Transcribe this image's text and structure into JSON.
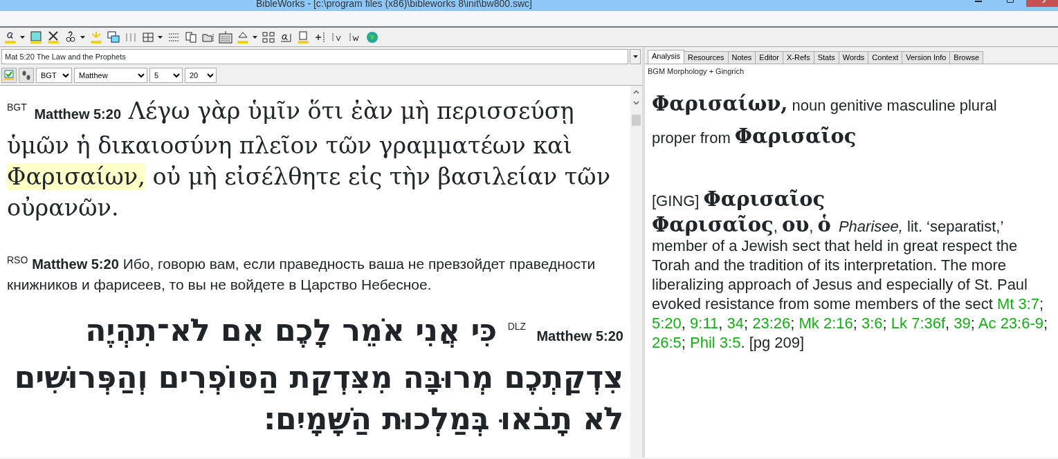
{
  "window": {
    "title": "BibleWorks - [c:\\program files (x86)\\bibleworks 8\\init\\bw800.swc]"
  },
  "left_pane": {
    "reference_box": "Mat 5:20 The Law and the Prophets",
    "selectors": [
      {
        "kind": "version",
        "value": "BGT"
      },
      {
        "kind": "book",
        "value": "Matthew"
      },
      {
        "kind": "chapter",
        "value": "5"
      },
      {
        "kind": "verse",
        "value": "20"
      }
    ],
    "verses": [
      {
        "kind": "greek",
        "version": "BGT",
        "reference": "Matthew 5:20",
        "parts": [
          {
            "text": "Λέγω γὰρ ὑμῖν ὅτι ἐὰν μὴ περισσεύσῃ ὑμῶν ἡ δικαιοσύνη πλεῖον τῶν γραμματέων καὶ ",
            "highlighted": false
          },
          {
            "text": "Φαρισαίων,",
            "highlighted": true
          },
          {
            "text": " οὐ μὴ εἰσέλθητε εἰς τὴν βασιλείαν τῶν οὐρανῶν.",
            "highlighted": false
          }
        ]
      },
      {
        "kind": "russian",
        "version": "RSO",
        "reference": "Matthew 5:20",
        "parts": [
          {
            "text": "Ибо, говорю вам, если праведность ваша не превзойдет праведности книжников и фарисеев, то вы не войдете в Царство Небесное.",
            "highlighted": false
          }
        ]
      },
      {
        "kind": "hebrew",
        "version": "DLZ",
        "reference": "Matthew 5:20",
        "parts": [
          {
            "text": "כִּי אֲנִי אֹמֵר לָכֶם אִם לֹא־תִהְיֶה צִדְקַתְכֶם מְרוּבָּה מִצִּדְקַת הַסּוֹפְרִים וְהַפְּרוּשִׁים לֹא תָבֹאוּ בְּמַלְכוּת הַשָּׁמָיִם׃",
            "highlighted": false
          }
        ]
      }
    ]
  },
  "right_pane": {
    "tabs": [
      {
        "label": "Analysis",
        "selected": true
      },
      {
        "label": "Resources",
        "selected": false
      },
      {
        "label": "Notes",
        "selected": false
      },
      {
        "label": "Editor",
        "selected": false
      },
      {
        "label": "X-Refs",
        "selected": false
      },
      {
        "label": "Stats",
        "selected": false
      },
      {
        "label": "Words",
        "selected": false
      },
      {
        "label": "Context",
        "selected": false
      },
      {
        "label": "Version Info",
        "selected": false
      },
      {
        "label": "Browse",
        "selected": false
      }
    ],
    "subtitle": "BGM Morphology + Gingrich",
    "analysis": {
      "word": "Φαρισαίων,",
      "parse": "noun genitive masculine plural proper from",
      "lemma": "Φαρισαῖος"
    },
    "lexicon": {
      "tag": "[GING]",
      "lemma": "Φαρισαῖος",
      "entry": [
        {
          "kind": "headword",
          "text": "Φαρισαῖος"
        },
        {
          "kind": "text",
          "text": ", "
        },
        {
          "kind": "headword",
          "text": "ου"
        },
        {
          "kind": "text",
          "text": ", "
        },
        {
          "kind": "headword",
          "text": "ὁ"
        },
        {
          "kind": "italic",
          "text": "Pharisee,"
        },
        {
          "kind": "text",
          "text": " lit. ‘separatist,’ member of a Jewish sect that held in great respect the Torah and the tradition of its interpretation. The more liberalizing approach of Jesus and especially of St. Paul evoked resistance from some members of the sect "
        },
        {
          "kind": "link",
          "text": "Mt 3:7"
        },
        {
          "kind": "text",
          "text": "; "
        },
        {
          "kind": "link",
          "text": "5:20"
        },
        {
          "kind": "text",
          "text": ", "
        },
        {
          "kind": "link",
          "text": "9:11"
        },
        {
          "kind": "text",
          "text": ", "
        },
        {
          "kind": "link",
          "text": "34"
        },
        {
          "kind": "text",
          "text": "; "
        },
        {
          "kind": "link",
          "text": "23:26"
        },
        {
          "kind": "text",
          "text": "; "
        },
        {
          "kind": "link",
          "text": "Mk 2:16"
        },
        {
          "kind": "text",
          "text": "; "
        },
        {
          "kind": "link",
          "text": "3:6"
        },
        {
          "kind": "text",
          "text": "; "
        },
        {
          "kind": "link",
          "text": "Lk 7:36f"
        },
        {
          "kind": "text",
          "text": ", "
        },
        {
          "kind": "link",
          "text": "39"
        },
        {
          "kind": "text",
          "text": "; "
        },
        {
          "kind": "link",
          "text": "Ac 23:6-9"
        },
        {
          "kind": "text",
          "text": "; "
        },
        {
          "kind": "link",
          "text": "26:5"
        },
        {
          "kind": "text",
          "text": "; "
        },
        {
          "kind": "link",
          "text": "Phil 3:5"
        },
        {
          "kind": "text",
          "text": ". [pg 209]"
        }
      ]
    }
  }
}
